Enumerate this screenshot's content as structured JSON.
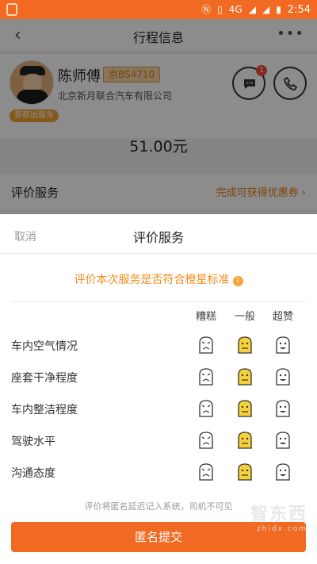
{
  "status_bar": {
    "network": "4G",
    "time": "2:54",
    "icons": [
      "lock-icon",
      "nfc-icon",
      "vibrate-icon",
      "signal-icon",
      "battery-icon"
    ]
  },
  "nav": {
    "back_icon": "chevron-left-icon",
    "title": "行程信息",
    "more_icon": "more-icon"
  },
  "driver": {
    "name": "陈师傅",
    "plate": "京BS4710",
    "company": "北京新月联合汽车有限公司",
    "badge": "首都出租车",
    "message_badge_count": "1"
  },
  "price": "51.00元",
  "evaluation_bar": {
    "label": "评价服务",
    "promo": "完成可获得优惠券 ›"
  },
  "sheet": {
    "cancel": "取消",
    "title": "评价服务",
    "question": "评价本次服务是否符合橙星标准",
    "columns": [
      "糟糕",
      "一般",
      "超赞"
    ],
    "rows": [
      {
        "label": "车内空气情况",
        "selected": "一般"
      },
      {
        "label": "座套干净程度",
        "selected": "一般"
      },
      {
        "label": "车内整洁程度",
        "selected": "一般"
      },
      {
        "label": "驾驶水平",
        "selected": "一般"
      },
      {
        "label": "沟通态度",
        "selected": "一般"
      }
    ],
    "note": "评价将匿名延迟记入系统，司机不可见",
    "submit": "匿名提交"
  },
  "watermark": {
    "logo": "智东西",
    "url": "zhidx.com"
  },
  "colors": {
    "accent": "#f26a21",
    "highlight": "#f08c1e",
    "selected_face": "#f5d23a"
  }
}
